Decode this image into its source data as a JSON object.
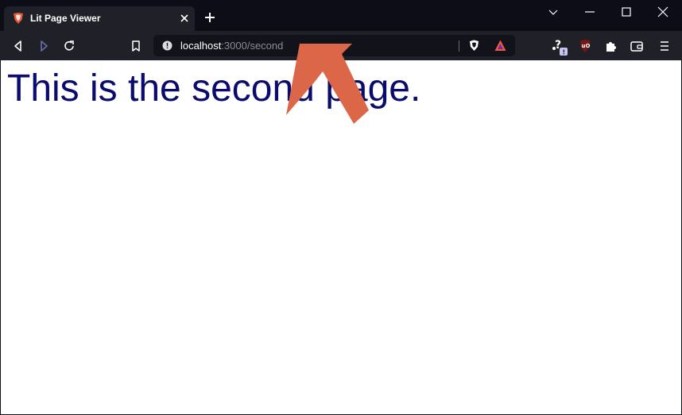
{
  "window": {
    "tab": {
      "title": "Lit Page Viewer",
      "favicon": "brave-lion-icon"
    },
    "controls": [
      "chevron-down-icon",
      "minimize-icon",
      "maximize-icon",
      "close-icon"
    ]
  },
  "toolbar": {
    "url": {
      "host": "localhost",
      "rest": ":3000/second"
    },
    "icons": [
      "back-icon",
      "forward-icon",
      "reload-icon",
      "bookmark-icon",
      "brave-shields-icon",
      "brave-rewards-icon",
      "extension-badge-icon",
      "ublock-icon",
      "extensions-puzzle-icon",
      "wallet-icon",
      "menu-icon"
    ]
  },
  "page": {
    "heading": "This is the second page."
  },
  "colors": {
    "accent_arrow": "#db6648",
    "heading": "#0b0b6e",
    "chrome_dark": "#0d0d17",
    "toolbar": "#202028"
  }
}
